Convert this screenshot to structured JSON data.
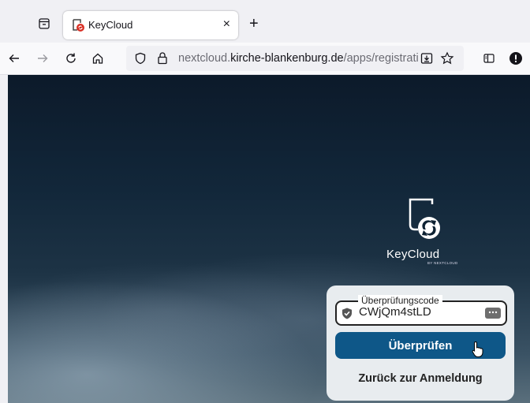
{
  "browser": {
    "tab": {
      "title": "KeyCloud",
      "close_label": "×"
    },
    "new_tab_label": "+",
    "url": {
      "prefix": "nextcloud.",
      "host": "kirche-blankenburg.de",
      "path": "/apps/registrati"
    }
  },
  "page": {
    "logo_text": "KeyCloud",
    "logo_subtext": "BY NEXTCLOUD",
    "form": {
      "code_label": "Überprüfungscode",
      "code_value": "CWjQm4stLD",
      "verify_button": "Überprüfen",
      "back_link": "Zurück zur Anmeldung"
    }
  },
  "colors": {
    "primary": "#0e5788",
    "panel": "#e8ecef"
  }
}
